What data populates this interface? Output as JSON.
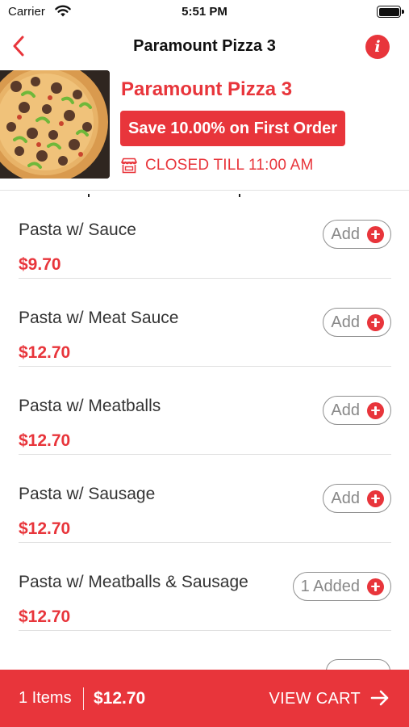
{
  "status_bar": {
    "carrier": "Carrier",
    "time": "5:51 PM"
  },
  "nav": {
    "title": "Paramount Pizza 3",
    "back_icon": "chevron-left-icon",
    "info_icon": "info-icon"
  },
  "store": {
    "name": "Paramount Pizza 3",
    "promo": "Save 10.00% on First Order",
    "status": "CLOSED TILL 11:00 AM",
    "status_icon": "store-icon"
  },
  "menu": {
    "items": [
      {
        "name": "Pasta w/ Sauce",
        "price": "$9.70",
        "button": "Add"
      },
      {
        "name": "Pasta w/ Meat Sauce",
        "price": "$12.70",
        "button": "Add"
      },
      {
        "name": "Pasta w/ Meatballs",
        "price": "$12.70",
        "button": "Add"
      },
      {
        "name": "Pasta w/ Sausage",
        "price": "$12.70",
        "button": "Add"
      },
      {
        "name": "Pasta w/ Meatballs & Sausage",
        "price": "$12.70",
        "button": "1 Added"
      }
    ]
  },
  "cart": {
    "count": "1 Items",
    "total": "$12.70",
    "action": "VIEW CART"
  },
  "colors": {
    "accent": "#e8353b",
    "text": "#333333",
    "muted": "#888888"
  }
}
